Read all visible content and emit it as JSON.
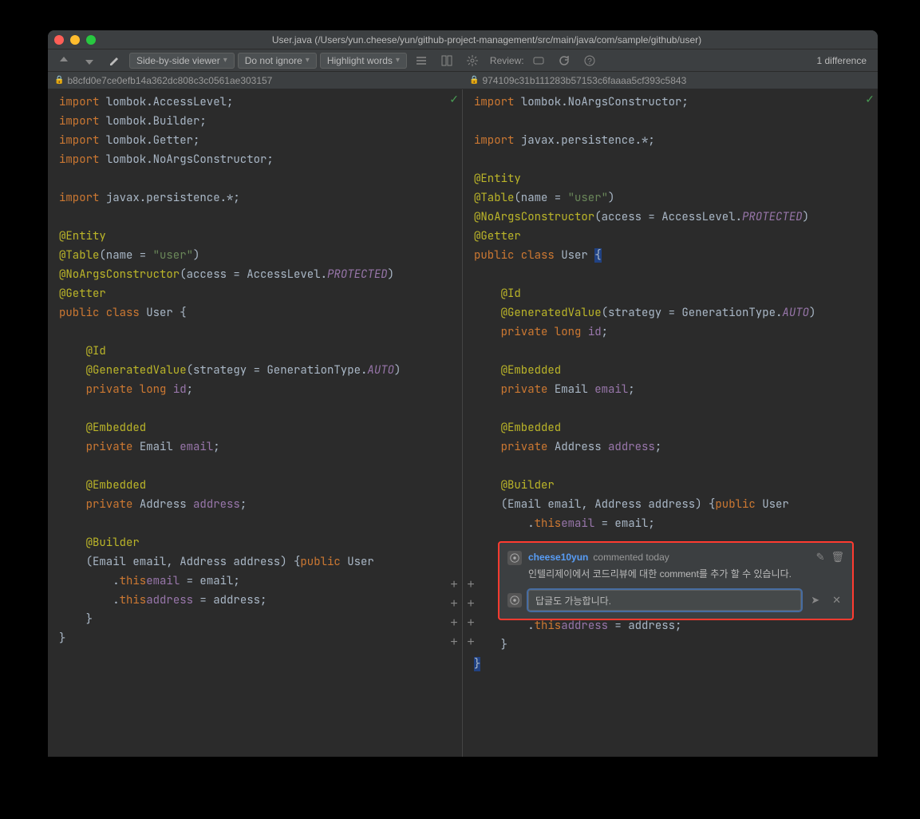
{
  "window": {
    "title": "User.java (/Users/yun.cheese/yun/github-project-management/src/main/java/com/sample/github/user)"
  },
  "toolbar": {
    "viewer_mode": "Side-by-side viewer",
    "ignore_mode": "Do not ignore",
    "highlight_mode": "Highlight words",
    "review_label": "Review:",
    "diff_count": "1 difference"
  },
  "hashes": {
    "left": "b8cfd0e7ce0efb14a362dc808c3c0561ae303157",
    "right": "974109c31b111283b57153c6faaaa5cf393c5843"
  },
  "left_code": {
    "lines": [
      {
        "t": "import ",
        "rest": "lombok.AccessLevel;"
      },
      {
        "t": "import ",
        "rest": "lombok.Builder;"
      },
      {
        "t": "import ",
        "rest": "lombok.Getter;"
      },
      {
        "t": "import ",
        "rest": "lombok.NoArgsConstructor;"
      },
      {
        "t": ""
      },
      {
        "t": "import ",
        "rest": "javax.persistence.*;"
      },
      {
        "t": ""
      },
      {
        "ann": "@Entity"
      },
      {
        "ann": "@Table",
        "post": "(name = ",
        "str": "\"user\"",
        "tail": ")"
      },
      {
        "ann": "@NoArgsConstructor",
        "post": "(access = AccessLevel.",
        "const": "PROTECTED",
        "tail": ")"
      },
      {
        "ann": "@Getter"
      },
      {
        "kw": "public class ",
        "cls": "User {"
      },
      {
        "t": ""
      },
      {
        "indent": "    ",
        "ann": "@Id"
      },
      {
        "indent": "    ",
        "ann": "@GeneratedValue",
        "post": "(strategy = GenerationType.",
        "const": "AUTO",
        "tail": ")"
      },
      {
        "indent": "    ",
        "kw": "private long ",
        "field": "id",
        "tail": ";"
      },
      {
        "t": ""
      },
      {
        "indent": "    ",
        "ann": "@Embedded"
      },
      {
        "indent": "    ",
        "kw": "private ",
        "cls": "Email ",
        "field": "email",
        "tail": ";"
      },
      {
        "t": ""
      },
      {
        "indent": "    ",
        "ann": "@Embedded"
      },
      {
        "indent": "    ",
        "kw": "private ",
        "cls": "Address ",
        "field": "address",
        "tail": ";"
      },
      {
        "t": ""
      },
      {
        "indent": "    ",
        "ann": "@Builder"
      },
      {
        "indent": "    ",
        "kw": "public ",
        "m": "User",
        "post": "(Email email, Address address) {"
      },
      {
        "indent": "        ",
        "kw": "this",
        "post": ".",
        "field": "email",
        "tail": " = email;"
      },
      {
        "indent": "        ",
        "kw": "this",
        "post": ".",
        "field": "address",
        "tail": " = address;"
      },
      {
        "indent": "    ",
        "post": "}"
      },
      {
        "post": "}"
      }
    ]
  },
  "right_code": {
    "lines": [
      {
        "t": "import ",
        "rest": "lombok.NoArgsConstructor;"
      },
      {
        "t": ""
      },
      {
        "t": "import ",
        "rest": "javax.persistence.*;"
      },
      {
        "t": ""
      },
      {
        "ann": "@Entity"
      },
      {
        "ann": "@Table",
        "post": "(name = ",
        "str": "\"user\"",
        "tail": ")"
      },
      {
        "ann": "@NoArgsConstructor",
        "post": "(access = AccessLevel.",
        "const": "PROTECTED",
        "tail": ")"
      },
      {
        "ann": "@Getter"
      },
      {
        "kw": "public class ",
        "cls": "User ",
        "brace": "{"
      },
      {
        "t": ""
      },
      {
        "indent": "    ",
        "ann": "@Id"
      },
      {
        "indent": "    ",
        "ann": "@GeneratedValue",
        "post": "(strategy = GenerationType.",
        "const": "AUTO",
        "tail": ")"
      },
      {
        "indent": "    ",
        "kw": "private long ",
        "field": "id",
        "tail": ";"
      },
      {
        "t": ""
      },
      {
        "indent": "    ",
        "ann": "@Embedded"
      },
      {
        "indent": "    ",
        "kw": "private ",
        "cls": "Email ",
        "field": "email",
        "tail": ";"
      },
      {
        "t": ""
      },
      {
        "indent": "    ",
        "ann": "@Embedded"
      },
      {
        "indent": "    ",
        "kw": "private ",
        "cls": "Address ",
        "field": "address",
        "tail": ";"
      },
      {
        "t": ""
      },
      {
        "indent": "    ",
        "ann": "@Builder"
      },
      {
        "indent": "    ",
        "kw": "public ",
        "m": "User",
        "post": "(Email email, Address address) {"
      },
      {
        "indent": "        ",
        "kw": "this",
        "post": ".",
        "field": "email",
        "tail": " = email;"
      }
    ],
    "after_comment": [
      {
        "indent": "        ",
        "kw": "this",
        "post": ".",
        "field": "address",
        "tail": " = address;"
      },
      {
        "indent": "    ",
        "post": "}"
      },
      {
        "brace": "}"
      }
    ]
  },
  "comment": {
    "author": "cheese10yun",
    "meta": "commented today",
    "text": "인텔리제이에서 코드리뷰에 대한 comment를 추가 할 수 있습니다.",
    "reply_value": "답글도 가능합니다."
  }
}
